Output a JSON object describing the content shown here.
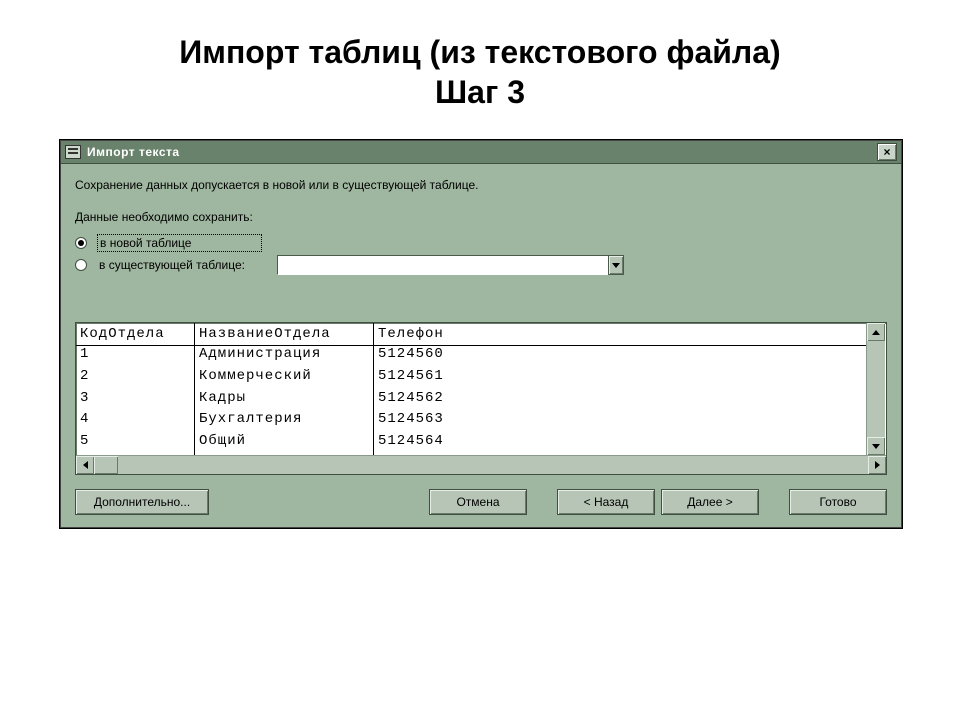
{
  "slide": {
    "title_line1": "Импорт таблиц (из текстового файла)",
    "title_line2": "Шаг 3"
  },
  "window": {
    "title": "Импорт текста",
    "close_glyph": "×"
  },
  "body": {
    "info": "Сохранение данных допускается в новой или в существующей таблице.",
    "save_prompt": "Данные необходимо сохранить:",
    "radio_new": "в новой таблице",
    "radio_existing": "в существующей таблице:",
    "combo_value": ""
  },
  "preview": {
    "headers": [
      "КодОтдела",
      "НазваниеОтдела",
      "Телефон"
    ],
    "rows": [
      [
        "1",
        "Администрация",
        "5124560"
      ],
      [
        "2",
        "Коммерческий",
        "5124561"
      ],
      [
        "3",
        "Кадры",
        "5124562"
      ],
      [
        "4",
        "Бухгалтерия",
        "5124563"
      ],
      [
        "5",
        "Общий",
        "5124564"
      ]
    ]
  },
  "buttons": {
    "advanced": "Дополнительно...",
    "cancel": "Отмена",
    "back": "< Назад",
    "next": "Далее >",
    "finish": "Готово"
  }
}
